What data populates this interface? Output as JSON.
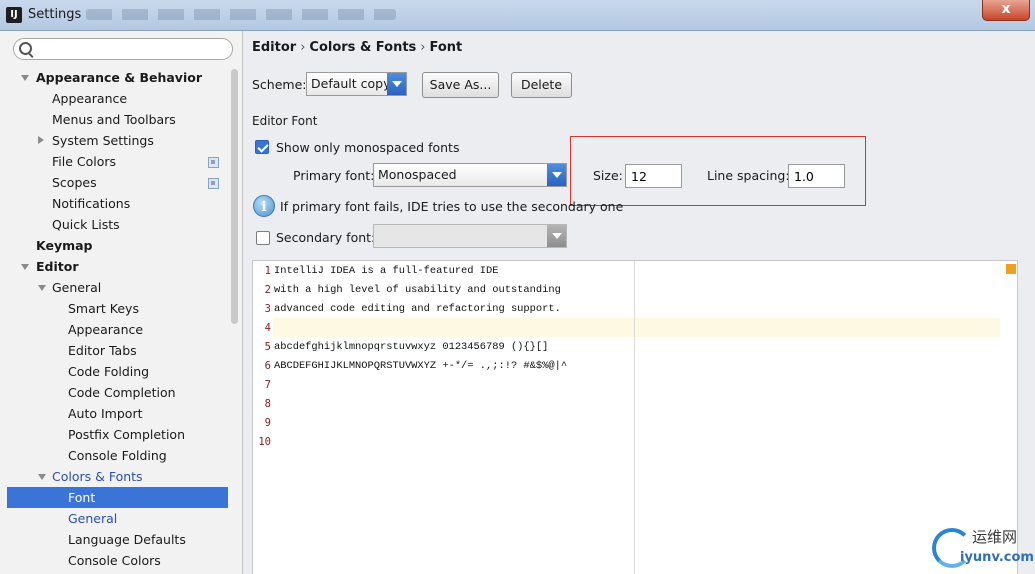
{
  "window": {
    "title": "Settings",
    "close_label": "x"
  },
  "sidebar": {
    "search_placeholder": "",
    "items": [
      {
        "label": "Appearance & Behavior"
      },
      {
        "label": "Appearance"
      },
      {
        "label": "Menus and Toolbars"
      },
      {
        "label": "System Settings"
      },
      {
        "label": "File Colors"
      },
      {
        "label": "Scopes"
      },
      {
        "label": "Notifications"
      },
      {
        "label": "Quick Lists"
      },
      {
        "label": "Keymap"
      },
      {
        "label": "Editor"
      },
      {
        "label": "General"
      },
      {
        "label": "Smart Keys"
      },
      {
        "label": "Appearance"
      },
      {
        "label": "Editor Tabs"
      },
      {
        "label": "Code Folding"
      },
      {
        "label": "Code Completion"
      },
      {
        "label": "Auto Import"
      },
      {
        "label": "Postfix Completion"
      },
      {
        "label": "Console Folding"
      },
      {
        "label": "Colors & Fonts"
      },
      {
        "label": "Font"
      },
      {
        "label": "General"
      },
      {
        "label": "Language Defaults"
      },
      {
        "label": "Console Colors"
      }
    ],
    "selected": "Font"
  },
  "breadcrumb": {
    "parts": [
      "Editor",
      "Colors & Fonts",
      "Font"
    ],
    "sep": "›"
  },
  "scheme": {
    "label": "Scheme:",
    "value": "Default copy",
    "save_as_label": "Save As...",
    "delete_label": "Delete"
  },
  "editor_font": {
    "section_label": "Editor Font",
    "mono_only_label": "Show only monospaced fonts",
    "mono_only_checked": true,
    "primary_label": "Primary font:",
    "primary_value": "Monospaced",
    "size_label": "Size:",
    "size_value": "12",
    "line_spacing_label": "Line spacing:",
    "line_spacing_value": "1.0",
    "info_text": "If primary font fails, IDE tries to use the secondary one",
    "secondary_label": "Secondary font:",
    "secondary_checked": false,
    "secondary_value": ""
  },
  "preview": {
    "line_numbers": [
      "1",
      "2",
      "3",
      "4",
      "5",
      "6",
      "7",
      "8",
      "9",
      "10"
    ],
    "lines": [
      "IntelliJ IDEA is a full-featured IDE",
      "with a high level of usability and outstanding",
      "advanced code editing and refactoring support.",
      "",
      "abcdefghijklmnopqrstuvwxyz 0123456789 (){}[]",
      "ABCDEFGHIJKLMNOPQRSTUVWXYZ +-*/= .,;:!? #&$%@|^",
      "",
      "",
      "",
      ""
    ]
  },
  "watermark": {
    "cn": "运维网",
    "en": "iyunv.com"
  },
  "colors": {
    "selection": "#3b74d7",
    "highlight_box": "#d9332b",
    "line_number": "#8c1b1b"
  }
}
